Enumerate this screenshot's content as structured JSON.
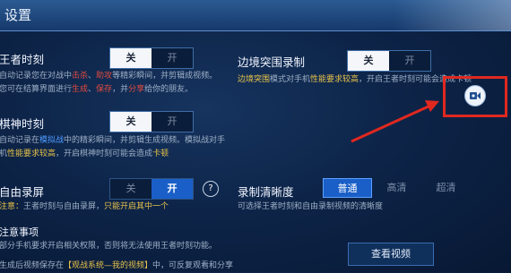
{
  "header": {
    "title": "设置"
  },
  "left": {
    "king_moment": {
      "title": "王者时刻",
      "toggle": {
        "off": "关",
        "on": "开"
      },
      "desc1_a": "自动记录您在对战中",
      "desc1_b": "击杀",
      "desc1_c": "、",
      "desc1_d": "助攻",
      "desc1_e": "等精彩瞬间，并剪辑成视频。",
      "desc2_a": "您可在结算界面进行",
      "desc2_b": "生成",
      "desc2_c": "、",
      "desc2_d": "保存",
      "desc2_e": "，并",
      "desc2_f": "分享",
      "desc2_g": "给你的朋友。"
    },
    "chess_moment": {
      "title": "棋神时刻",
      "toggle": {
        "off": "关",
        "on": "开"
      },
      "desc1_a": "自动记录在",
      "desc1_b": "模拟战",
      "desc1_c": "中的精彩瞬间，并剪辑生成视频。模拟战对手",
      "desc2_a": "机",
      "desc2_b": "性能要求较高",
      "desc2_c": "，开启棋神时刻可能会造成",
      "desc2_d": "卡顿"
    },
    "free_record": {
      "title": "自由录屏",
      "toggle": {
        "off": "关",
        "on": "开"
      },
      "help": "?",
      "note_a": "注意：",
      "note_b": "王者时刻与自由录屏，",
      "note_c": "只能开启其中一个"
    },
    "notice": {
      "title": "注意事项",
      "line1": "部分手机要求开启相关权限，否则将无法使用王者时刻功能。",
      "line2_a": "生成后视频保存在",
      "line2_b": "【观战系统—我的视频】",
      "line2_c": "中，可反复观看和分享"
    }
  },
  "right": {
    "border_record": {
      "title": "边境突围录制",
      "toggle": {
        "off": "关",
        "on": "开"
      },
      "desc1_a": "边境突围",
      "desc1_b": "模式对手机",
      "desc1_c": "性能要求较高",
      "desc1_d": "，开启王者时刻可能会造成卡顿"
    },
    "clarity": {
      "title": "录制清晰度",
      "options": [
        "普通",
        "高清",
        "超清"
      ],
      "desc": "可选择王者时刻和自由录制视频的清晰度"
    },
    "view_video_button": "查看视频",
    "camera_icon": "video-camera-icon"
  },
  "colors": {
    "highlight_red": "#e14b40",
    "highlight_yellow": "#e6c24a",
    "accent_blue": "#1a5fc8",
    "annotation_red": "#e0281f"
  }
}
